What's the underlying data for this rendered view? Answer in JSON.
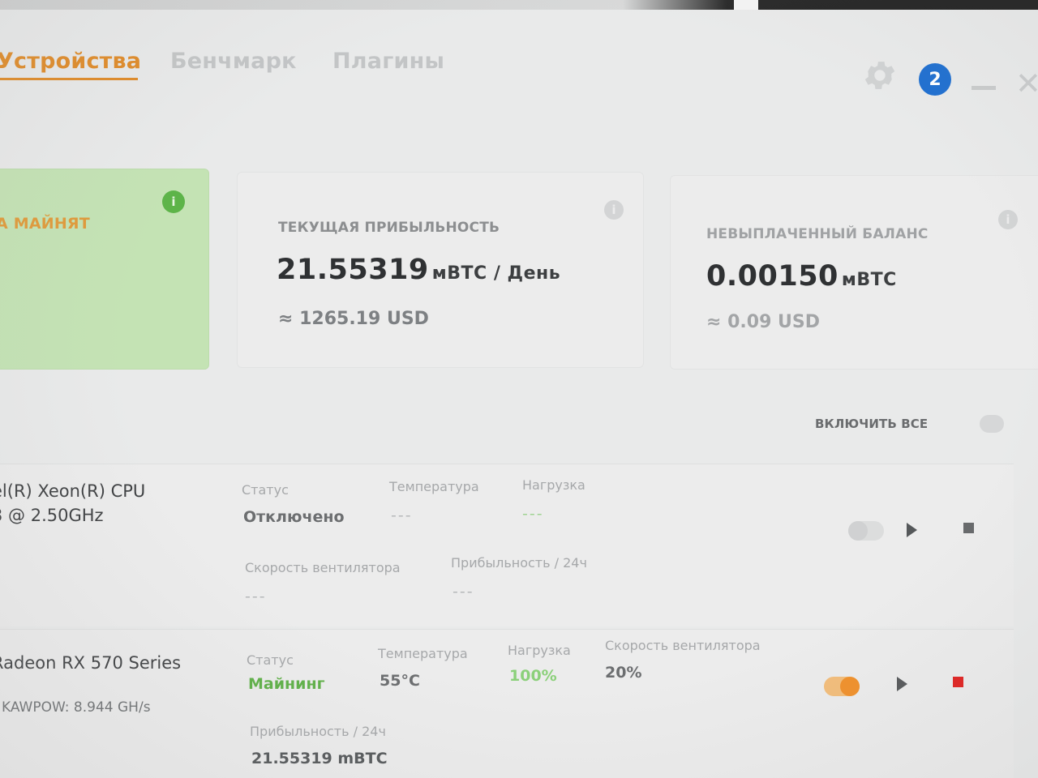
{
  "tabs": {
    "devices": "Устройства",
    "benchmark": "Бенчмарк",
    "plugins": "Плагины"
  },
  "header": {
    "notification_count": "2"
  },
  "cards": {
    "mining": {
      "label": "А МАЙНЯТ",
      "info_icon": "info-icon"
    },
    "profitability": {
      "label": "ТЕКУЩАЯ ПРИБЫЛЬНОСТЬ",
      "value": "21.55319",
      "unit": "мBTC / День",
      "fiat": "≈ 1265.19 USD"
    },
    "balance": {
      "label": "НЕВЫПЛАЧЕННЫЙ БАЛАНС",
      "value": "0.00150",
      "unit": "мBTC",
      "fiat": "≈ 0.09 USD"
    }
  },
  "enable_all": {
    "label": "ВКЛЮЧИТЬ ВСЕ"
  },
  "devices": [
    {
      "name_line1": "el(R) Xeon(R) CPU",
      "name_line2": "3 @ 2.50GHz",
      "status_label": "Статус",
      "status_value": "Отключено",
      "temp_label": "Температура",
      "temp_value": "---",
      "load_label": "Нагрузка",
      "load_value": "---",
      "fan_label": "Скорость вентилятора",
      "fan_value": "---",
      "profit_label": "Прибыльность / 24ч",
      "profit_value": "---",
      "enabled": false
    },
    {
      "name_line1": "Radeon RX 570 Series",
      "algo": "KAWPOW: 8.944 GH/s",
      "status_label": "Статус",
      "status_value": "Майнинг",
      "temp_label": "Температура",
      "temp_value": "55°C",
      "load_label": "Нагрузка",
      "load_value": "100%",
      "fan_label": "Скорость вентилятора",
      "fan_value": "20%",
      "profit_label": "Прибыльность / 24ч",
      "profit_value": "21.55319 mBTC",
      "enabled": true
    }
  ],
  "colors": {
    "accent": "#e08a26",
    "mining_card": "#c4e3b4",
    "status_green": "#5fb048",
    "stop_red": "#e0201e",
    "badge_blue": "#1f6fd0"
  }
}
